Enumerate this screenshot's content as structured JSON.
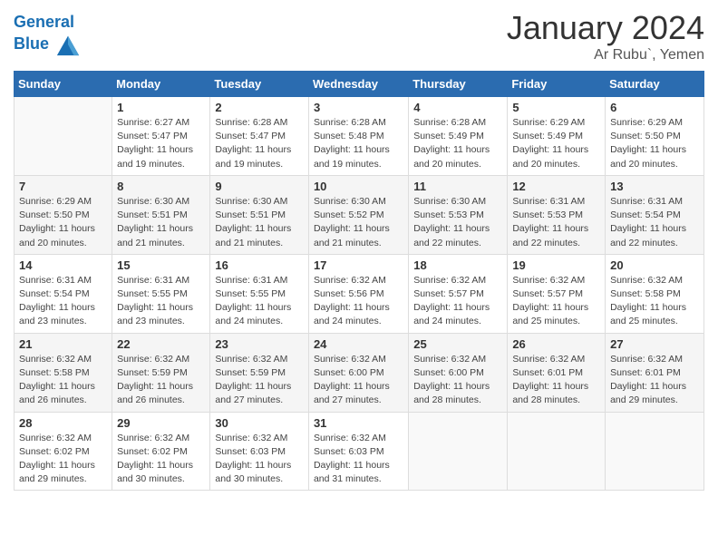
{
  "logo": {
    "line1": "General",
    "line2": "Blue"
  },
  "title": "January 2024",
  "subtitle": "Ar Rubu`, Yemen",
  "days_header": [
    "Sunday",
    "Monday",
    "Tuesday",
    "Wednesday",
    "Thursday",
    "Friday",
    "Saturday"
  ],
  "weeks": [
    [
      {
        "day": "",
        "info": ""
      },
      {
        "day": "1",
        "info": "Sunrise: 6:27 AM\nSunset: 5:47 PM\nDaylight: 11 hours\nand 19 minutes."
      },
      {
        "day": "2",
        "info": "Sunrise: 6:28 AM\nSunset: 5:47 PM\nDaylight: 11 hours\nand 19 minutes."
      },
      {
        "day": "3",
        "info": "Sunrise: 6:28 AM\nSunset: 5:48 PM\nDaylight: 11 hours\nand 19 minutes."
      },
      {
        "day": "4",
        "info": "Sunrise: 6:28 AM\nSunset: 5:49 PM\nDaylight: 11 hours\nand 20 minutes."
      },
      {
        "day": "5",
        "info": "Sunrise: 6:29 AM\nSunset: 5:49 PM\nDaylight: 11 hours\nand 20 minutes."
      },
      {
        "day": "6",
        "info": "Sunrise: 6:29 AM\nSunset: 5:50 PM\nDaylight: 11 hours\nand 20 minutes."
      }
    ],
    [
      {
        "day": "7",
        "info": "Sunrise: 6:29 AM\nSunset: 5:50 PM\nDaylight: 11 hours\nand 20 minutes."
      },
      {
        "day": "8",
        "info": "Sunrise: 6:30 AM\nSunset: 5:51 PM\nDaylight: 11 hours\nand 21 minutes."
      },
      {
        "day": "9",
        "info": "Sunrise: 6:30 AM\nSunset: 5:51 PM\nDaylight: 11 hours\nand 21 minutes."
      },
      {
        "day": "10",
        "info": "Sunrise: 6:30 AM\nSunset: 5:52 PM\nDaylight: 11 hours\nand 21 minutes."
      },
      {
        "day": "11",
        "info": "Sunrise: 6:30 AM\nSunset: 5:53 PM\nDaylight: 11 hours\nand 22 minutes."
      },
      {
        "day": "12",
        "info": "Sunrise: 6:31 AM\nSunset: 5:53 PM\nDaylight: 11 hours\nand 22 minutes."
      },
      {
        "day": "13",
        "info": "Sunrise: 6:31 AM\nSunset: 5:54 PM\nDaylight: 11 hours\nand 22 minutes."
      }
    ],
    [
      {
        "day": "14",
        "info": "Sunrise: 6:31 AM\nSunset: 5:54 PM\nDaylight: 11 hours\nand 23 minutes."
      },
      {
        "day": "15",
        "info": "Sunrise: 6:31 AM\nSunset: 5:55 PM\nDaylight: 11 hours\nand 23 minutes."
      },
      {
        "day": "16",
        "info": "Sunrise: 6:31 AM\nSunset: 5:55 PM\nDaylight: 11 hours\nand 24 minutes."
      },
      {
        "day": "17",
        "info": "Sunrise: 6:32 AM\nSunset: 5:56 PM\nDaylight: 11 hours\nand 24 minutes."
      },
      {
        "day": "18",
        "info": "Sunrise: 6:32 AM\nSunset: 5:57 PM\nDaylight: 11 hours\nand 24 minutes."
      },
      {
        "day": "19",
        "info": "Sunrise: 6:32 AM\nSunset: 5:57 PM\nDaylight: 11 hours\nand 25 minutes."
      },
      {
        "day": "20",
        "info": "Sunrise: 6:32 AM\nSunset: 5:58 PM\nDaylight: 11 hours\nand 25 minutes."
      }
    ],
    [
      {
        "day": "21",
        "info": "Sunrise: 6:32 AM\nSunset: 5:58 PM\nDaylight: 11 hours\nand 26 minutes."
      },
      {
        "day": "22",
        "info": "Sunrise: 6:32 AM\nSunset: 5:59 PM\nDaylight: 11 hours\nand 26 minutes."
      },
      {
        "day": "23",
        "info": "Sunrise: 6:32 AM\nSunset: 5:59 PM\nDaylight: 11 hours\nand 27 minutes."
      },
      {
        "day": "24",
        "info": "Sunrise: 6:32 AM\nSunset: 6:00 PM\nDaylight: 11 hours\nand 27 minutes."
      },
      {
        "day": "25",
        "info": "Sunrise: 6:32 AM\nSunset: 6:00 PM\nDaylight: 11 hours\nand 28 minutes."
      },
      {
        "day": "26",
        "info": "Sunrise: 6:32 AM\nSunset: 6:01 PM\nDaylight: 11 hours\nand 28 minutes."
      },
      {
        "day": "27",
        "info": "Sunrise: 6:32 AM\nSunset: 6:01 PM\nDaylight: 11 hours\nand 29 minutes."
      }
    ],
    [
      {
        "day": "28",
        "info": "Sunrise: 6:32 AM\nSunset: 6:02 PM\nDaylight: 11 hours\nand 29 minutes."
      },
      {
        "day": "29",
        "info": "Sunrise: 6:32 AM\nSunset: 6:02 PM\nDaylight: 11 hours\nand 30 minutes."
      },
      {
        "day": "30",
        "info": "Sunrise: 6:32 AM\nSunset: 6:03 PM\nDaylight: 11 hours\nand 30 minutes."
      },
      {
        "day": "31",
        "info": "Sunrise: 6:32 AM\nSunset: 6:03 PM\nDaylight: 11 hours\nand 31 minutes."
      },
      {
        "day": "",
        "info": ""
      },
      {
        "day": "",
        "info": ""
      },
      {
        "day": "",
        "info": ""
      }
    ]
  ]
}
